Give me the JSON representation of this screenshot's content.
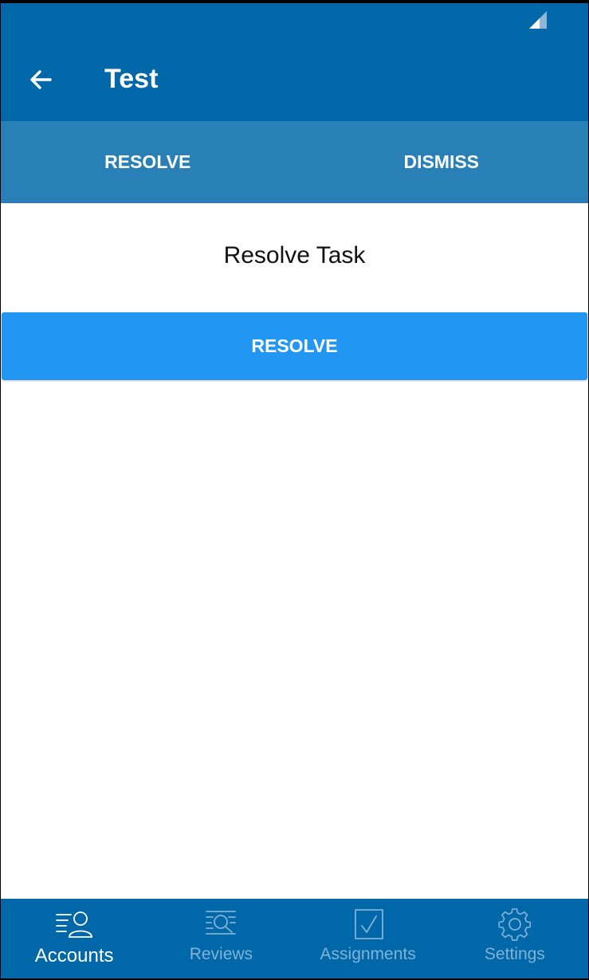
{
  "app": {
    "title": "Test"
  },
  "tabs": [
    {
      "label": "RESOLVE"
    },
    {
      "label": "DISMISS"
    }
  ],
  "main": {
    "heading": "Resolve Task",
    "resolve_button": "RESOLVE"
  },
  "bottom_nav": [
    {
      "label": "Accounts",
      "icon": "accounts-icon",
      "active": true
    },
    {
      "label": "Reviews",
      "icon": "reviews-icon",
      "active": false
    },
    {
      "label": "Assignments",
      "icon": "assignments-icon",
      "active": false
    },
    {
      "label": "Settings",
      "icon": "settings-icon",
      "active": false
    }
  ],
  "colors": {
    "primary": "#0067a9",
    "tabbar": "#2880b6",
    "button": "#2196f3",
    "inactive_nav": "#7fb3d6"
  }
}
